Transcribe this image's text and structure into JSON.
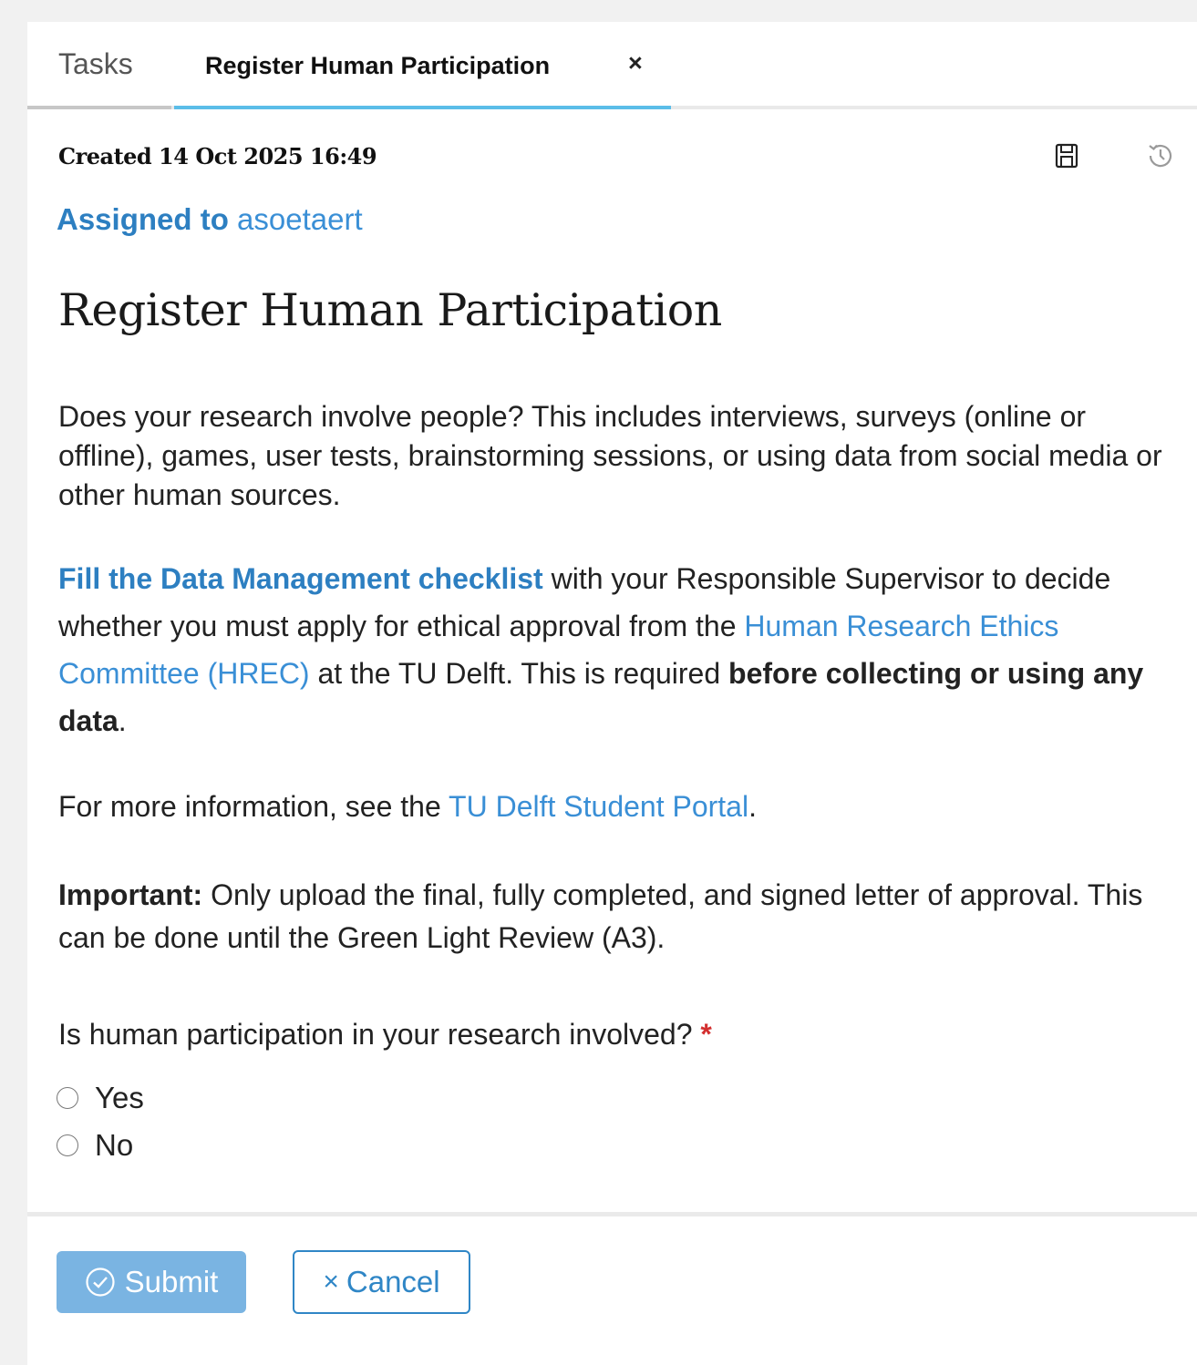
{
  "tabs": {
    "tasks_label": "Tasks",
    "active_label": "Register Human Participation",
    "close_glyph": "×"
  },
  "meta": {
    "created": "Created 14 Oct 2025 16:49",
    "assigned_prefix": "Assigned to",
    "assigned_user": "asoetaert"
  },
  "icons": {
    "save": "save-icon",
    "history": "history-icon",
    "submit": "check-circle-icon",
    "cancel": "close-icon"
  },
  "content": {
    "title": "Register Human Participation",
    "intro": "Does your research involve people? This includes interviews, surveys (online or offline), games, user tests, brainstorming sessions, or using data from social media or other human sources.",
    "checklist_link": "Fill the Data Management checklist",
    "p2_text1": " with your Responsible Supervisor to decide whether you must apply for ethical approval from the ",
    "hrec_link": "Human Research Ethics Committee (HREC)",
    "p2_text2": " at the TU Delft. This is required ",
    "p2_bold": "before collecting or using any data",
    "p2_end": ".",
    "p3_text": "For more information, see the ",
    "portal_link": "TU Delft Student Portal",
    "p3_end": ".",
    "important_label": "Important:",
    "important_text": " Only upload the final, fully completed, and signed letter of approval. This can be done until the Green Light Review (A3)."
  },
  "form": {
    "question": "Is human participation in your research involved?",
    "required_marker": "*",
    "options": [
      "Yes",
      "No"
    ]
  },
  "actions": {
    "submit_label": "Submit",
    "cancel_label": "Cancel",
    "cancel_glyph": "×"
  },
  "colors": {
    "accent": "#3a8fd6",
    "tab_underline": "#5bbde8",
    "submit_bg": "#7ab4e2",
    "required": "#d32f2f"
  }
}
